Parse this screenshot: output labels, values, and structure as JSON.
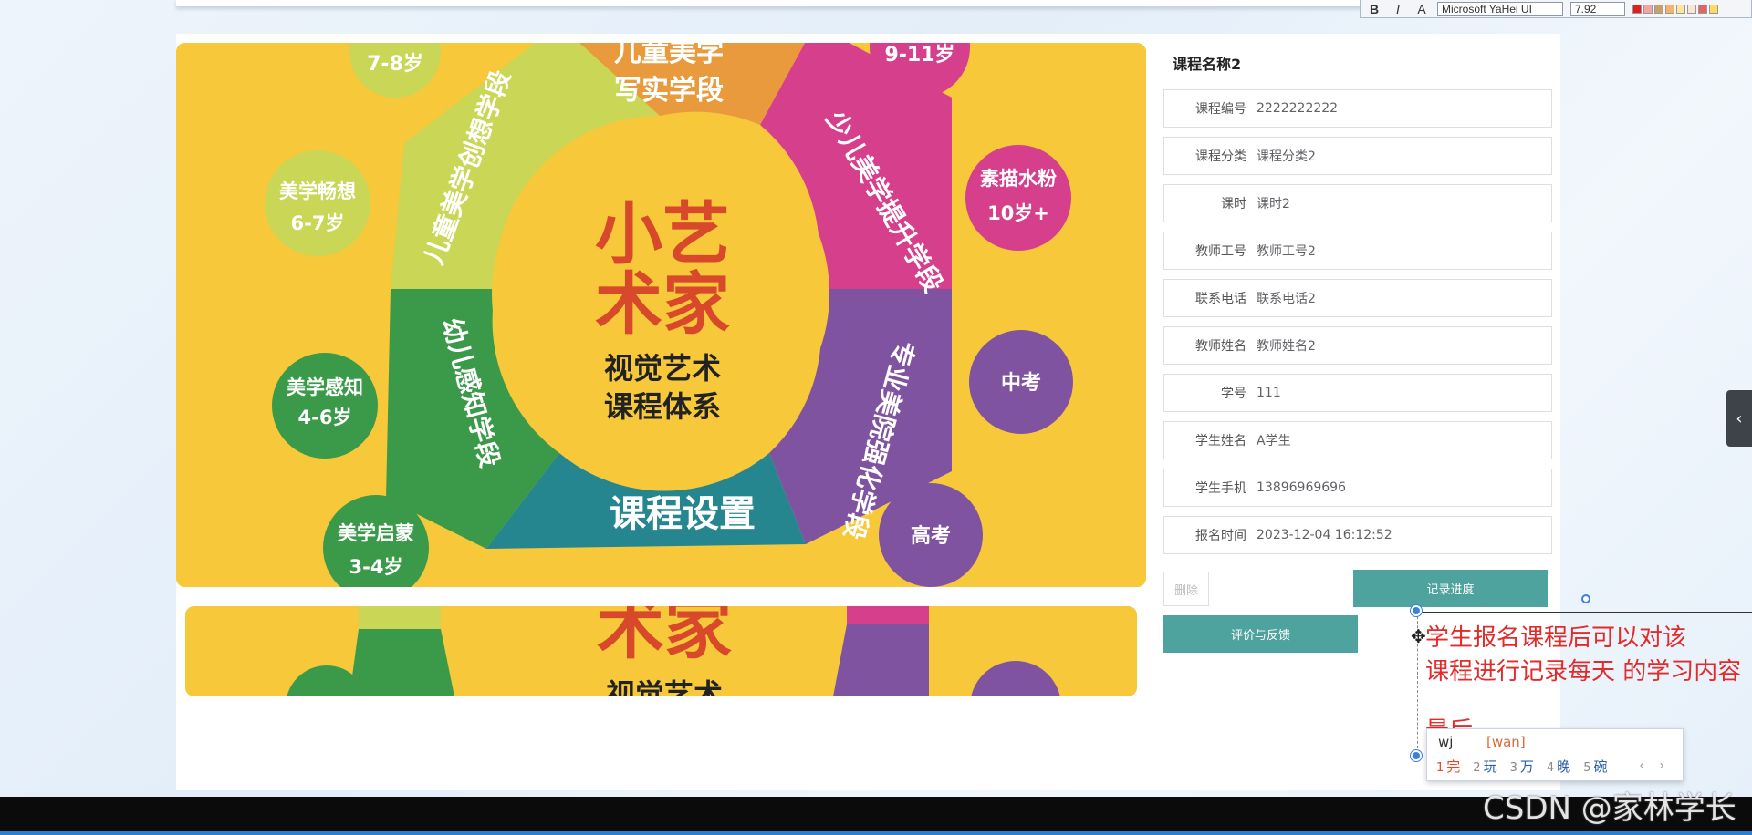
{
  "toolbar": {
    "bold": "B",
    "italic": "I",
    "outline": "A",
    "font": "Microsoft YaHei UI",
    "size": "7.92",
    "swatches": [
      "#e02020",
      "#f2a3a3",
      "#c8a070",
      "#f6b26b",
      "#ffe599",
      "#fbe5d6",
      "#e06666",
      "#ffd966"
    ]
  },
  "poster": {
    "title_line1": "小艺",
    "title_line2": "术家",
    "subtitle_line1": "视觉艺术",
    "subtitle_line2": "课程体系",
    "segment_orange": "写实学段",
    "segment_orange_top": "儿童美学",
    "segment_pink": "少儿美学提升学段",
    "segment_lime": "儿童美学创想学段",
    "segment_green": "幼儿感知学段",
    "segment_purple": "专业美院强化学段",
    "segment_teal": "课程设置",
    "bubble_78": "7-8岁",
    "bubble_911": "9-11岁",
    "bubble_changxiang": "美学畅想",
    "bubble_changxiang_age": "6-7岁",
    "bubble_sumiao": "素描水粉",
    "bubble_sumiao_age": "10岁+",
    "bubble_ganzhi": "美学感知",
    "bubble_ganzhi_age": "4-6岁",
    "bubble_zhongkao": "中考",
    "bubble_qimeng": "美学启蒙",
    "bubble_qimeng_age": "3-4岁",
    "bubble_gaokao": "高考"
  },
  "detail": {
    "course_name": "课程名称2",
    "fields": [
      {
        "label": "课程编号",
        "value": "2222222222"
      },
      {
        "label": "课程分类",
        "value": "课程分类2"
      },
      {
        "label": "课时",
        "value": "课时2"
      },
      {
        "label": "教师工号",
        "value": "教师工号2"
      },
      {
        "label": "联系电话",
        "value": "联系电话2"
      },
      {
        "label": "教师姓名",
        "value": "教师姓名2"
      },
      {
        "label": "学号",
        "value": "111"
      },
      {
        "label": "学生姓名",
        "value": "A学生"
      },
      {
        "label": "学生手机",
        "value": "13896969696"
      },
      {
        "label": "报名时间",
        "value": "2023-12-04 16:12:52"
      }
    ],
    "delete_label": "删除",
    "record_label": "记录进度",
    "feedback_label": "评价与反馈"
  },
  "annotation": {
    "line1": "学生报名课程后可以对该",
    "line2": "课程进行记录每天 的学习内容",
    "line3": "最后"
  },
  "ime": {
    "composition": "wj",
    "pinyin": "[wan]",
    "candidates": [
      {
        "n": "1",
        "c": "完"
      },
      {
        "n": "2",
        "c": "玩"
      },
      {
        "n": "3",
        "c": "万"
      },
      {
        "n": "4",
        "c": "晚"
      },
      {
        "n": "5",
        "c": "碗"
      }
    ],
    "nav": "‹ ›"
  },
  "side_tab": "‹",
  "watermark": "CSDN @家林学长",
  "colors": {
    "teal_button": "#4ea39f",
    "annotation_red": "#e32b2b",
    "poster_yellow": "#f6c83a"
  }
}
